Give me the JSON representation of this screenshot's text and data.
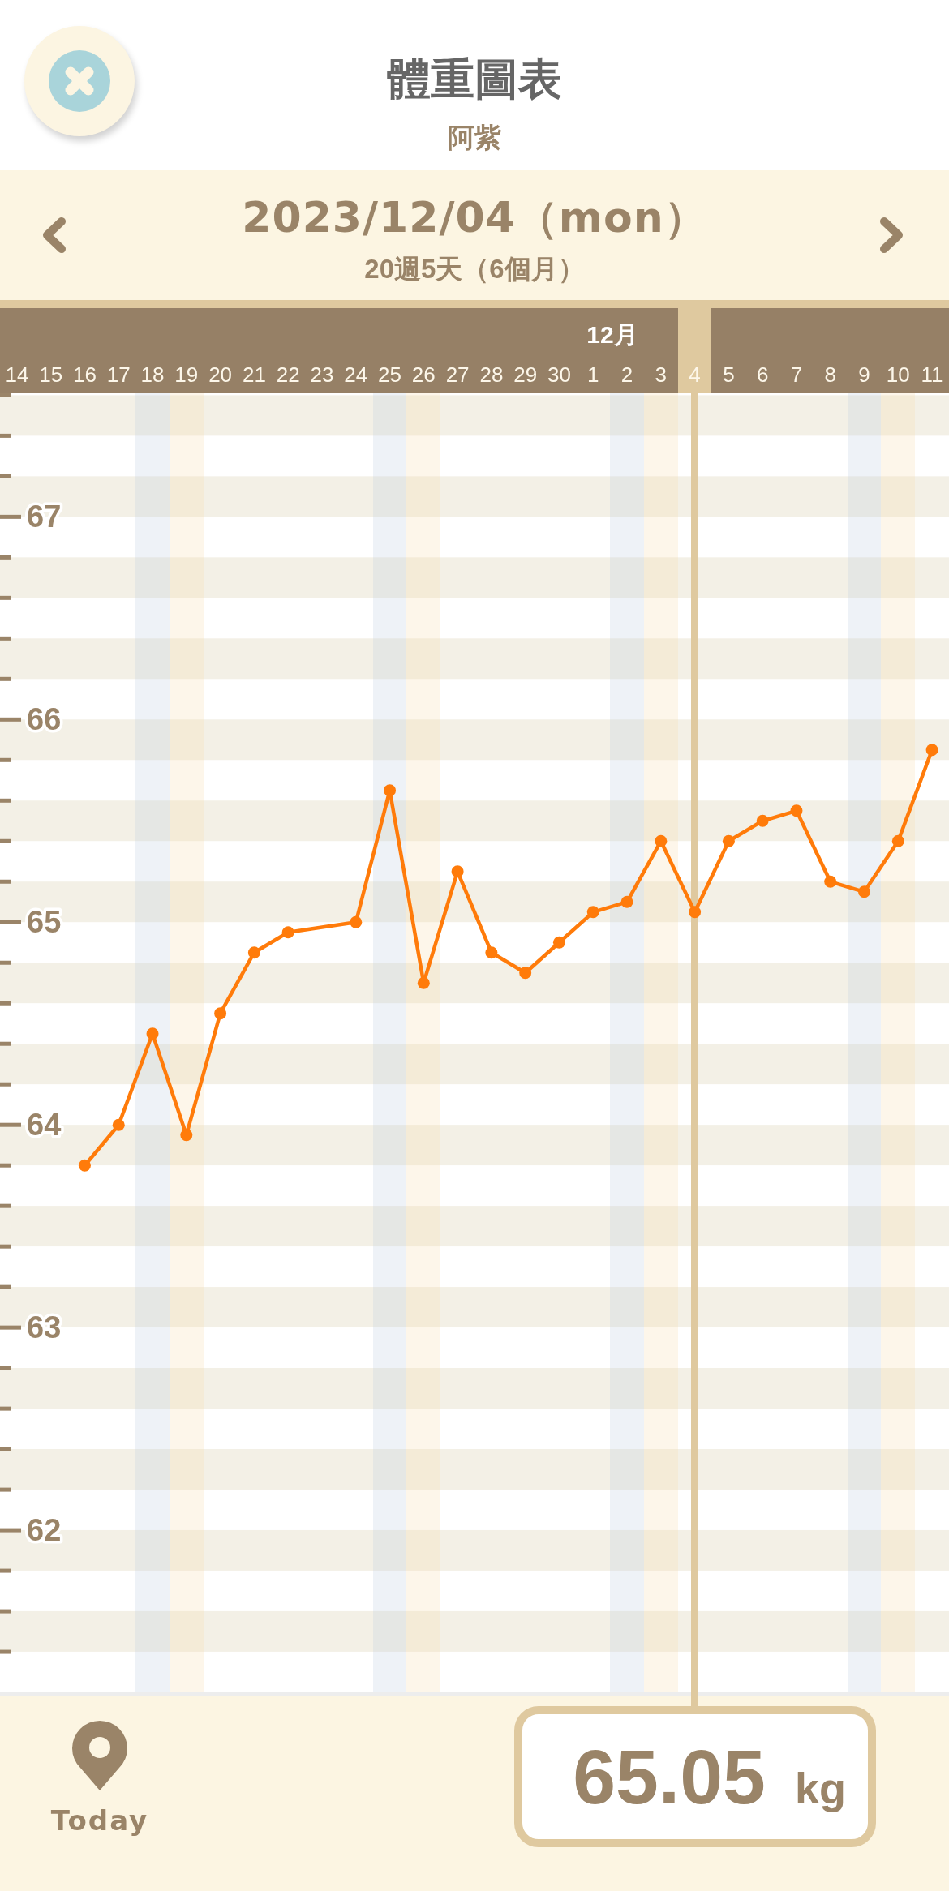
{
  "header": {
    "title": "體重圖表",
    "subtitle": "阿紫"
  },
  "date_nav": {
    "date": "2023/12/04（mon）",
    "age": "20週5天（6個月）"
  },
  "date_strip": {
    "days": [
      {
        "kind": "weekday",
        "selected": false
      },
      {
        "kind": "weekday",
        "selected": false
      },
      {
        "kind": "weekday",
        "selected": false
      },
      {
        "kind": "weekday",
        "selected": false
      },
      {
        "kind": "saturday",
        "selected": false
      },
      {
        "kind": "sunday",
        "selected": false
      },
      {
        "kind": "weekday",
        "selected": false
      },
      {
        "kind": "weekday",
        "selected": false
      },
      {
        "kind": "weekday",
        "selected": false
      },
      {
        "kind": "weekday",
        "selected": false
      },
      {
        "kind": "weekday",
        "selected": false
      },
      {
        "kind": "saturday",
        "selected": false
      },
      {
        "kind": "sunday",
        "selected": false
      },
      {
        "kind": "weekday",
        "selected": false
      },
      {
        "kind": "weekday",
        "selected": false
      },
      {
        "kind": "weekday",
        "selected": false
      },
      {
        "kind": "weekday",
        "selected": false
      },
      {
        "month": "12月",
        "kind": "weekday",
        "selected": false
      },
      {
        "kind": "saturday",
        "selected": false
      },
      {
        "kind": "sunday",
        "selected": false
      },
      {
        "kind": "weekday",
        "selected": true
      },
      {
        "kind": "weekday",
        "selected": false
      },
      {
        "kind": "weekday",
        "selected": false
      },
      {
        "kind": "weekday",
        "selected": false
      },
      {
        "kind": "weekday",
        "selected": false
      },
      {
        "kind": "saturday",
        "selected": false
      },
      {
        "kind": "sunday",
        "selected": false
      },
      {
        "kind": "weekday",
        "selected": false
      }
    ]
  },
  "chart": {
    "chart_data": {
      "type": "line",
      "categories": [
        "14",
        "15",
        "16",
        "17",
        "18",
        "19",
        "20",
        "21",
        "22",
        "23",
        "24",
        "25",
        "26",
        "27",
        "28",
        "29",
        "30",
        "1",
        "2",
        "3",
        "4",
        "5",
        "6",
        "7",
        "8",
        "9",
        "10",
        "11"
      ],
      "series": [
        {
          "color": "#ff7b0a",
          "marker": "circle",
          "values": [
            null,
            null,
            63.8,
            64.0,
            64.45,
            63.95,
            64.55,
            64.85,
            64.95,
            null,
            65.0,
            65.65,
            64.7,
            65.25,
            64.85,
            64.75,
            64.9,
            65.05,
            65.1,
            65.4,
            65.05,
            65.4,
            65.5,
            65.55,
            65.2,
            65.15,
            65.4,
            65.85
          ]
        }
      ],
      "ylim": [
        60.22,
        69.55
      ],
      "yticks": [
        62,
        63,
        64,
        65,
        66,
        67
      ]
    }
  },
  "footer": {
    "today_button": "Today",
    "reading": {
      "value": "65.05",
      "unit": "kg"
    }
  }
}
